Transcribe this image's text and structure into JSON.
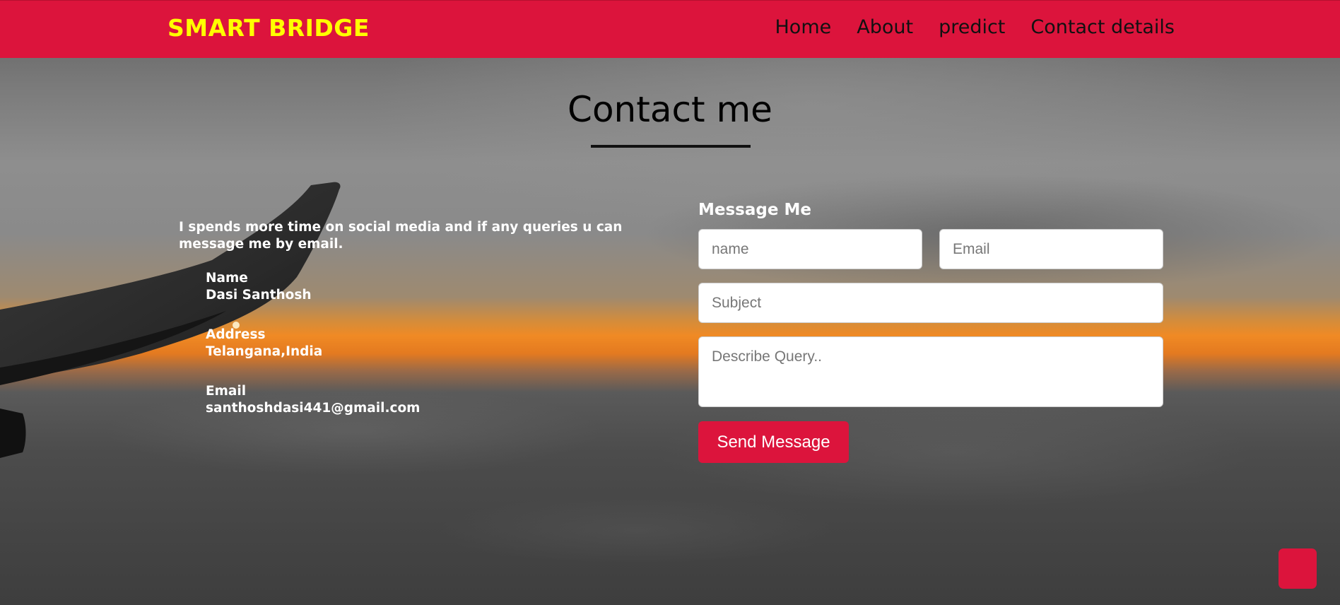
{
  "navbar": {
    "brand": "SMART BRIDGE",
    "links": [
      {
        "label": "Home"
      },
      {
        "label": "About"
      },
      {
        "label": "predict"
      },
      {
        "label": "Contact details"
      }
    ]
  },
  "contact": {
    "title": "Contact me",
    "intro": "I spends more time on social media and if any queries u can message me by email.",
    "items": [
      {
        "label": "Name",
        "value": "Dasi Santhosh"
      },
      {
        "label": "Address",
        "value": "Telangana,India"
      },
      {
        "label": "Email",
        "value": "santhoshdasi441@gmail.com"
      }
    ]
  },
  "form": {
    "title": "Message Me",
    "name_placeholder": "name",
    "email_placeholder": "Email",
    "subject_placeholder": "Subject",
    "query_placeholder": "Describe Query..",
    "send_label": "Send Message"
  },
  "colors": {
    "accent": "#dc143c",
    "brand_text": "#ffff00"
  }
}
